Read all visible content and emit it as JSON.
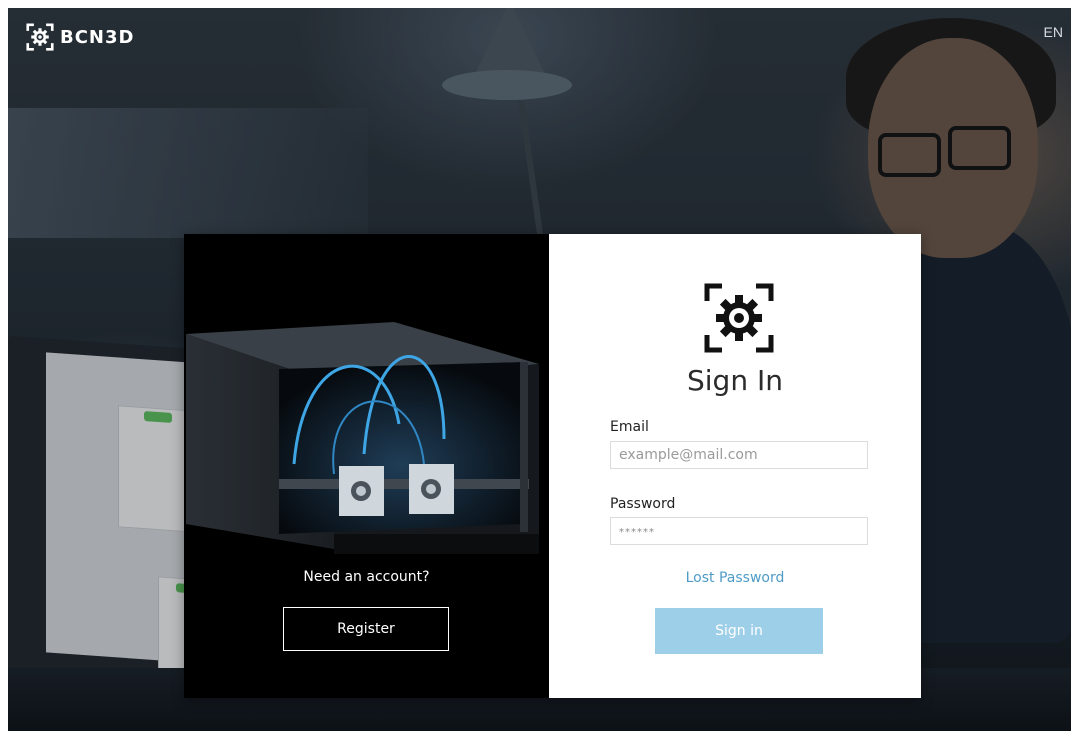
{
  "header": {
    "brand_name": "BCN3D",
    "language": "EN"
  },
  "register_panel": {
    "prompt": "Need an account?",
    "register_label": "Register"
  },
  "signin": {
    "title": "Sign In",
    "email_label": "Email",
    "email_placeholder": "example@mail.com",
    "email_value": "",
    "password_label": "Password",
    "password_placeholder": "******",
    "password_value": "",
    "lost_password_label": "Lost Password",
    "submit_label": "Sign in"
  },
  "icons": {
    "brand": "gear-in-brackets-icon"
  },
  "colors": {
    "accent": "#9ecfe8",
    "link": "#4f9bc6",
    "panel_dark": "#000000",
    "panel_light": "#ffffff"
  }
}
